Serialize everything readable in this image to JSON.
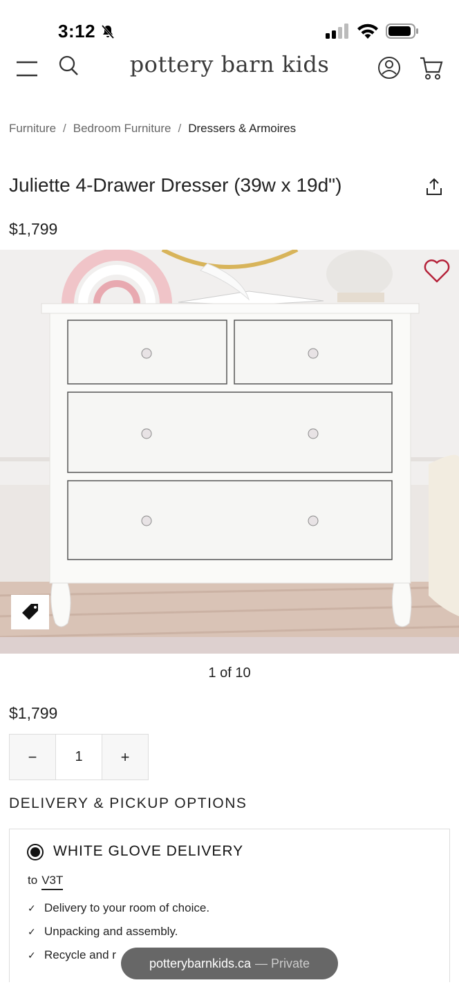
{
  "status_bar": {
    "time": "3:12"
  },
  "header": {
    "logo": "pottery barn kids",
    "icons": [
      "menu-icon",
      "search-icon",
      "account-icon",
      "cart-icon"
    ]
  },
  "breadcrumbs": [
    "Furniture",
    "Bedroom Furniture",
    "Dressers & Armoires"
  ],
  "breadcrumb_separator": "/",
  "product": {
    "title": "Juliette 4-Drawer Dresser (39w x 19d\")",
    "price": "$1,799",
    "image_counter": "1 of 10",
    "quantity": "1",
    "qty_minus": "−",
    "qty_plus": "+"
  },
  "delivery": {
    "heading": "DELIVERY & PICKUP OPTIONS",
    "option_title": "WHITE GLOVE DELIVERY",
    "to_label": "to",
    "postal_code": "V3T",
    "features": [
      "Delivery to your room of choice.",
      "Unpacking and assembly.",
      "Recycle and r"
    ]
  },
  "toast": {
    "domain": "potterybarnkids.ca",
    "suffix": "— Private"
  },
  "colors": {
    "wishlist_heart": "#b5223a",
    "text": "#222222"
  }
}
